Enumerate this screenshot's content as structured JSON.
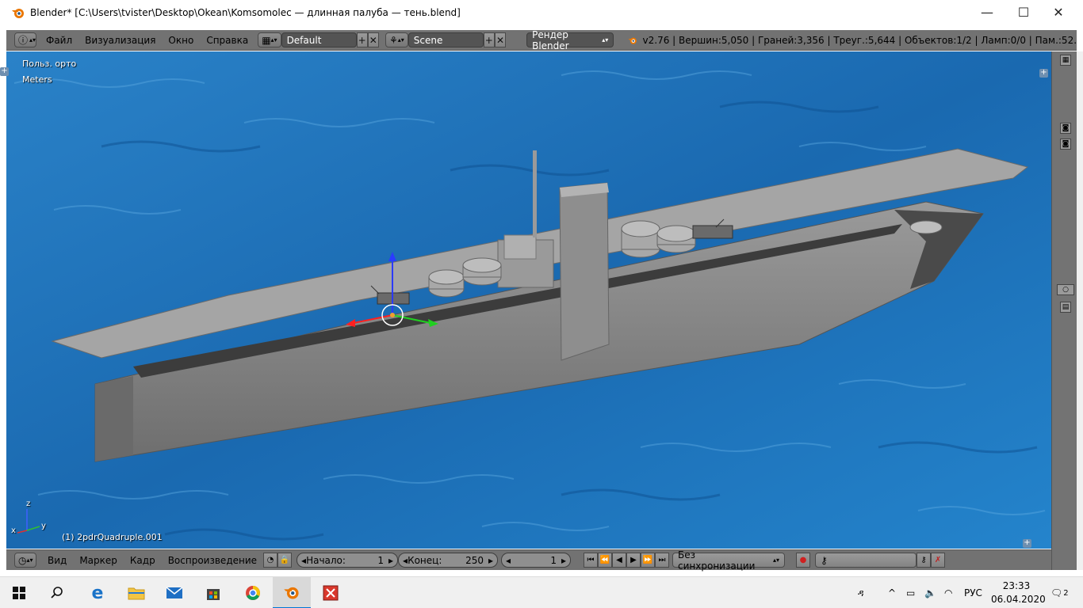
{
  "window": {
    "title": "Blender* [C:\\Users\\tvister\\Desktop\\Okean\\Komsomolec — длинная палуба — тень.blend]",
    "minimize": "—",
    "maximize": "☐",
    "close": "✕"
  },
  "header": {
    "menus": [
      "Файл",
      "Визуализация",
      "Окно",
      "Справка"
    ],
    "layout": "Default",
    "scene": "Scene",
    "render_engine": "Рендер Blender",
    "stats": "v2.76 | Вершин:5,050 | Граней:3,356 | Треуг.:5,644 | Объектов:1/2 | Ламп:0/0 | Пам.:52."
  },
  "viewport": {
    "view_label": "Польз. орто",
    "units_label": "Meters",
    "object_label": "(1) 2pdrQuadruple.001",
    "axis_z": "z",
    "axis_y": "y",
    "axis_x": "x",
    "background_color": "#1c6bb0"
  },
  "timeline": {
    "menus": [
      "Вид",
      "Маркер",
      "Кадр",
      "Воспроизведение"
    ],
    "start_label": "Начало:",
    "start_value": "1",
    "end_label": "Конец:",
    "end_value": "250",
    "current_frame": "1",
    "sync": "Без синхронизации"
  },
  "taskbar": {
    "language": "РУС",
    "time": "23:33",
    "date": "06.04.2020",
    "notifications": "2"
  },
  "colors": {
    "blender_header": "#727272",
    "water": "#1c6bb0",
    "ship": "#8c8c8c",
    "accent": "#0078d7"
  }
}
